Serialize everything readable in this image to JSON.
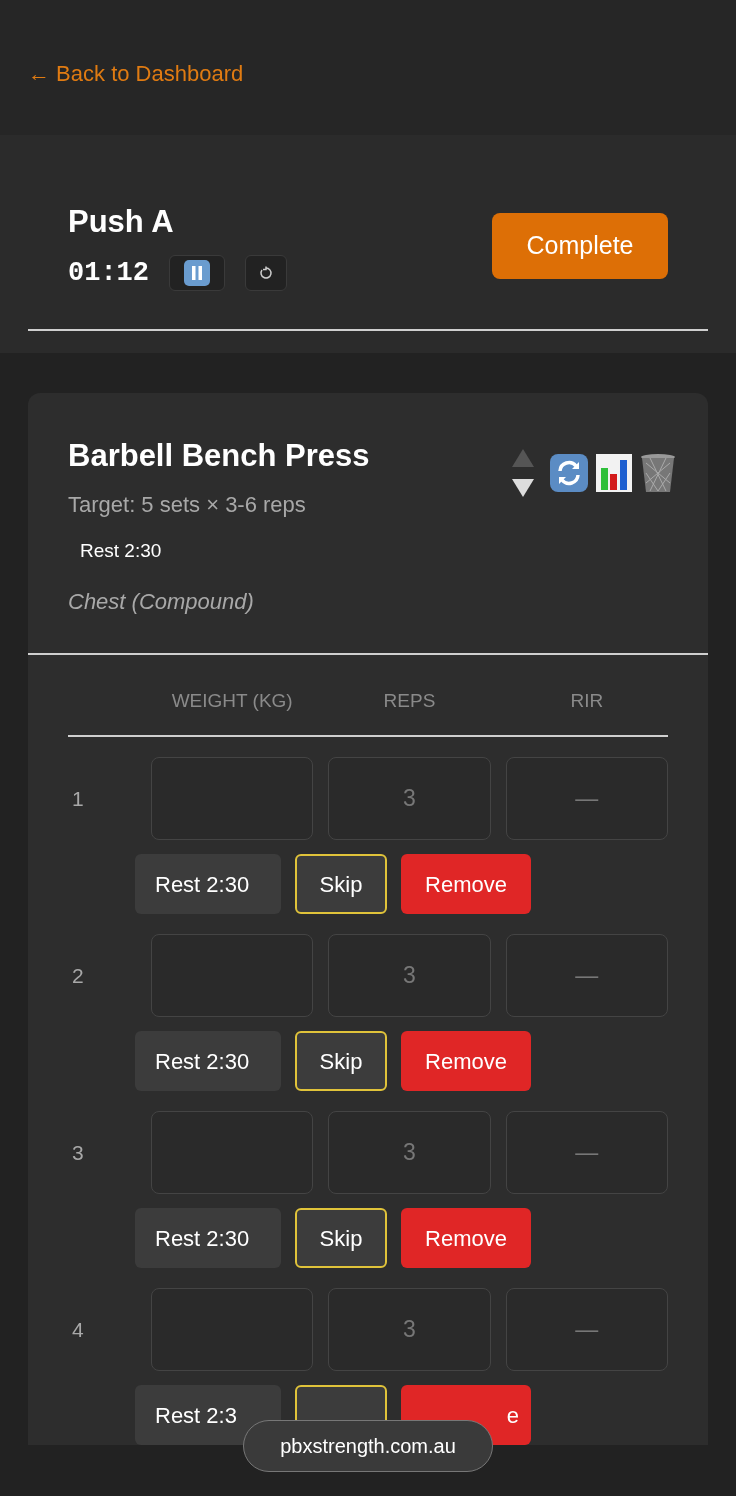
{
  "back_link": "← Back to Dashboard",
  "workout": {
    "title": "Push A",
    "timer": "01:12",
    "complete_button": "Complete"
  },
  "exercise": {
    "name": "Barbell Bench Press",
    "target": "Target: 5 sets × 3-6 reps",
    "rest": "Rest 2:30",
    "muscle": "Chest (Compound)",
    "columns": [
      "WEIGHT (KG)",
      "REPS",
      "RIR"
    ],
    "sets": [
      {
        "number": "1",
        "reps_placeholder": "3",
        "rir_placeholder": "—",
        "rest": "Rest 2:30",
        "skip": "Skip",
        "remove": "Remove"
      },
      {
        "number": "2",
        "reps_placeholder": "3",
        "rir_placeholder": "—",
        "rest": "Rest 2:30",
        "skip": "Skip",
        "remove": "Remove"
      },
      {
        "number": "3",
        "reps_placeholder": "3",
        "rir_placeholder": "—",
        "rest": "Rest 2:30",
        "skip": "Skip",
        "remove": "Remove"
      },
      {
        "number": "4",
        "reps_placeholder": "3",
        "rir_placeholder": "—",
        "rest": "Rest 2:3",
        "remove": "e"
      }
    ]
  },
  "address_bar": {
    "url": "pbxstrength.com.au"
  }
}
